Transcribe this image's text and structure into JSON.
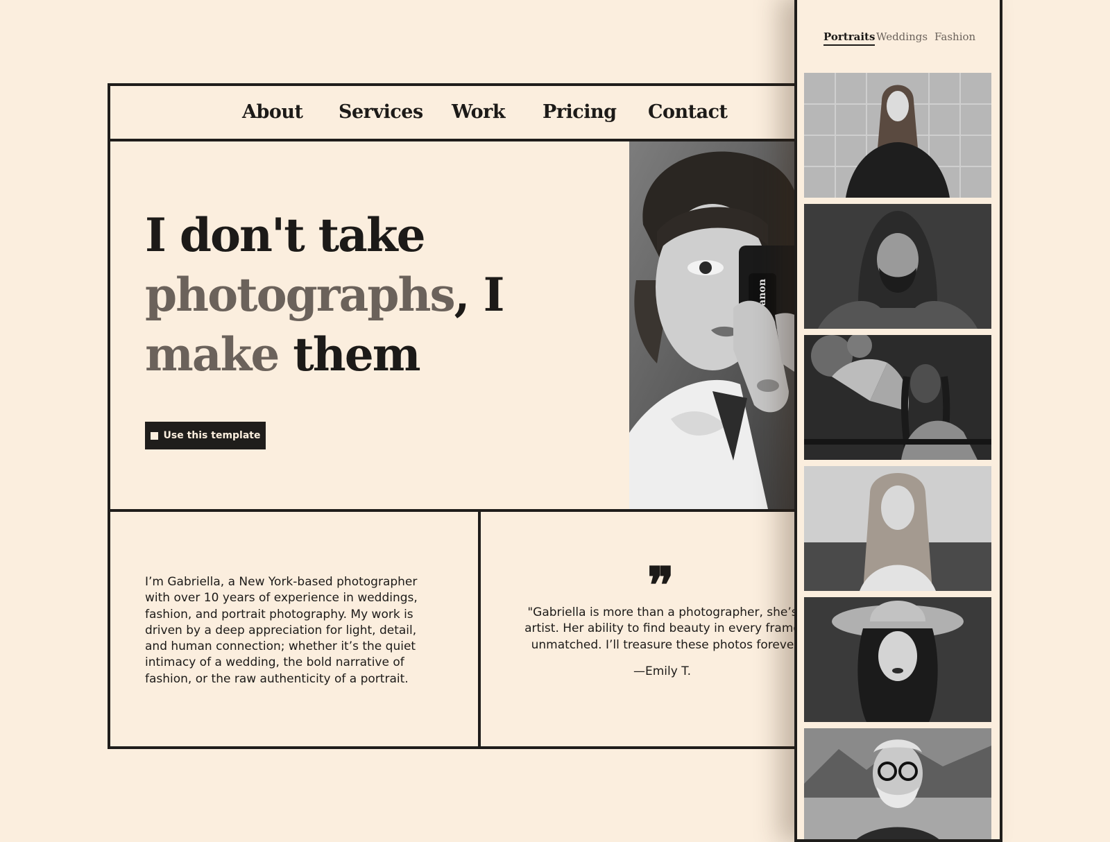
{
  "nav": {
    "items": [
      "About",
      "Services",
      "Work",
      "Pricing",
      "Contact"
    ]
  },
  "hero": {
    "headline_line1": "I don't take",
    "headline_word_muted_1": "photographs",
    "headline_comma_i": ", I",
    "headline_word_muted_2": "make",
    "headline_word_end": " them",
    "cta_label": "Use this template",
    "photo_camera_brand": "Canon"
  },
  "about": {
    "bio": "I’m Gabriella, a New York-based photographer with over 10 years of experience in weddings, fashion, and portrait photography. My work is driven by a deep appreciation for light, detail, and human connection; whether it’s the quiet intimacy of a wedding, the bold narrative of fashion, or the raw authenticity of a portrait."
  },
  "testimonial": {
    "quote_mark": "❞",
    "line1": "\"Gabriella is more than a photographer, she’s",
    "line2": "artist. Her ability to find beauty in every frame",
    "line3": "unmatched. I’ll treasure these photos foreve",
    "author": "—Emily T."
  },
  "gallery": {
    "tabs": [
      {
        "label": "Portraits",
        "active": true
      },
      {
        "label": "Weddings",
        "active": false
      },
      {
        "label": "Fashion",
        "active": false
      }
    ],
    "photos": [
      "woman-tiled-wall",
      "bearded-man-hood",
      "woman-with-fan",
      "blonde-woman-outdoors",
      "woman-in-hat",
      "older-man-glasses"
    ]
  },
  "colors": {
    "background": "#fbeede",
    "ink": "#1f1d1b",
    "muted": "#6b625b"
  }
}
